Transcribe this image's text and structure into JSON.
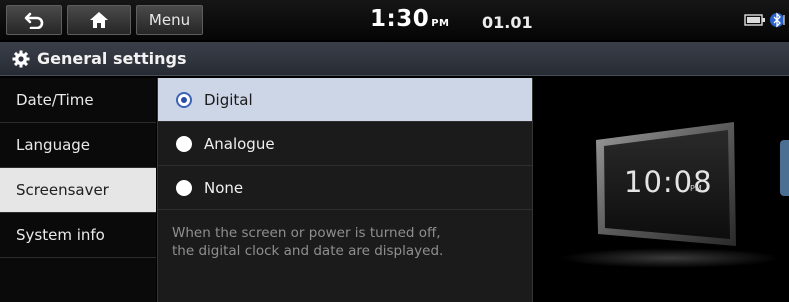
{
  "statusbar": {
    "back_icon": "back-arrow-icon",
    "home_icon": "home-icon",
    "menu_label": "Menu",
    "time": "1:30",
    "ampm": "PM",
    "date": "01.01",
    "battery_icon": "battery-icon",
    "bluetooth_icon": "bluetooth-icon"
  },
  "header": {
    "icon": "gear-icon",
    "title": "General settings"
  },
  "sidebar": {
    "items": [
      {
        "label": "Date/Time"
      },
      {
        "label": "Language"
      },
      {
        "label": "Screensaver"
      },
      {
        "label": "System info"
      }
    ],
    "active_index": 2
  },
  "options": {
    "items": [
      {
        "label": "Digital",
        "selected": true
      },
      {
        "label": "Analogue",
        "selected": false
      },
      {
        "label": "None",
        "selected": false
      }
    ],
    "description_line1": "When the screen or power is turned off,",
    "description_line2": "the digital clock and date are displayed."
  },
  "preview": {
    "time": "10:08",
    "ampm": "PM"
  },
  "colors": {
    "accent": "#3d63b8",
    "selected_bg": "#cdd6e6",
    "active_side_bg": "#e6e6e6",
    "side_tab": "#4b6e93"
  }
}
